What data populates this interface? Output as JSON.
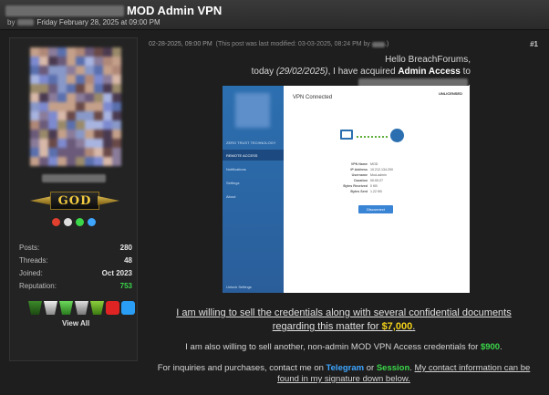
{
  "thread": {
    "title": "MOD Admin VPN",
    "by_label": "by",
    "date": "Friday February 28, 2025 at 09:00 PM"
  },
  "author": {
    "rank": "GOD",
    "stats": [
      {
        "label": "Posts:",
        "value": "280"
      },
      {
        "label": "Threads:",
        "value": "48"
      },
      {
        "label": "Joined:",
        "value": "Oct 2023"
      },
      {
        "label": "Reputation:",
        "value": "753"
      }
    ],
    "view_all": "View All"
  },
  "post": {
    "timestamp": "02-28-2025, 09:00 PM",
    "edited_note": "(This post was last modified: 03-03-2025, 08:24 PM by",
    "edited_close": ".)",
    "number": "#1",
    "greeting": "Hello BreachForums,",
    "acquired_prefix": "today ",
    "acquired_date": "(29/02/2025)",
    "acquired_mid": ", I have acquired ",
    "acquired_bold": "Admin Access",
    "acquired_to": " to",
    "sell_line1": "I am willing to sell the credentials along with several confidential documents",
    "sell_line2": "regarding this matter for ",
    "sell_price": "$7,000",
    "also_text": "I am also willing to sell another, non-admin MOD VPN Access credentials for ",
    "also_price": "$900",
    "contact_prefix": "For inquiries and purchases, contact me on ",
    "contact_tg": "Telegram",
    "contact_or": " or ",
    "contact_session": "Session",
    "contact_suffix": ". ",
    "contact_link1": "My contact information can be",
    "contact_link2": "found in my signature down below."
  },
  "screenshot": {
    "status": "VPN Connected",
    "license": "UNLICENSED",
    "nav": [
      "ZERO TRUST TECHNOLOGY",
      "REMOTE ACCESS",
      "Notifications",
      "Settings",
      "About",
      "Unlock Settings"
    ],
    "info": [
      {
        "k": "VPN Name",
        "v": "MOD"
      },
      {
        "k": "IP Address",
        "v": "10.212.134.200"
      },
      {
        "k": "Username",
        "v": "Mod-admin"
      },
      {
        "k": "Duration",
        "v": "00:00:27"
      },
      {
        "k": "Bytes Received",
        "v": "0 KB"
      },
      {
        "k": "Bytes Sent",
        "v": "1.22 KB"
      }
    ],
    "button": "Disconnect"
  },
  "colors": {
    "accent_green": "#3bd64a",
    "accent_gold": "#f2d21a",
    "telegram_blue": "#3ea6ff"
  }
}
